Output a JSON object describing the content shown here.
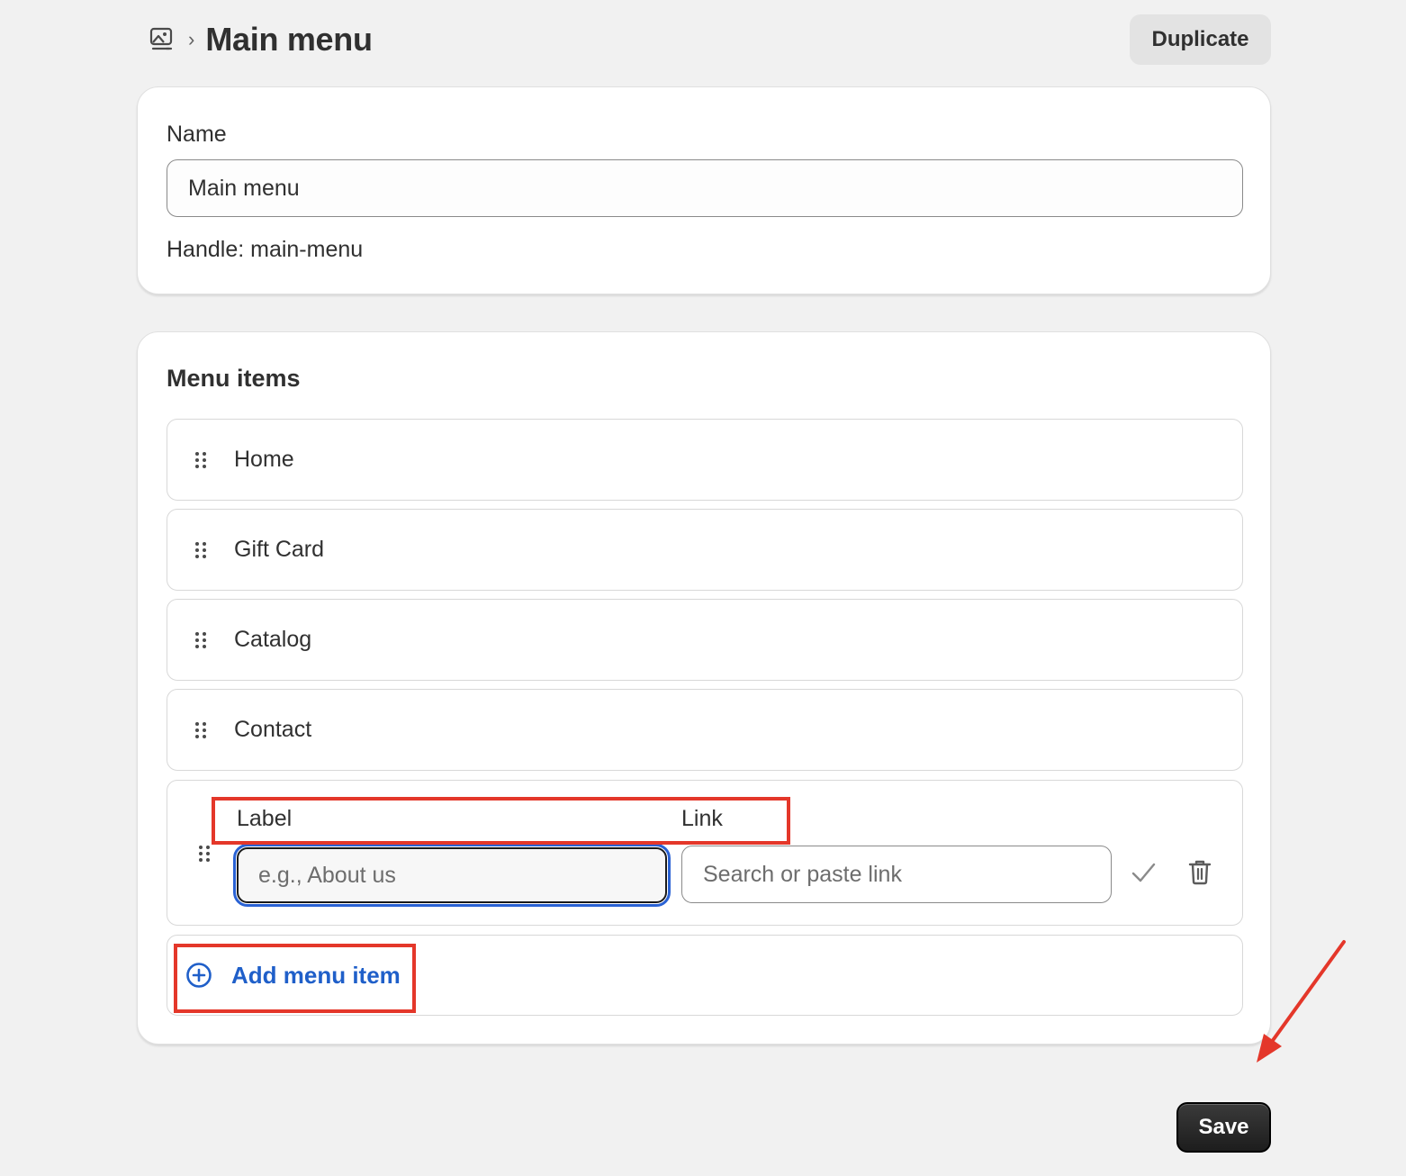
{
  "header": {
    "breadcrumb_icon": "online-store-menu-icon",
    "separator": "›",
    "title": "Main menu",
    "duplicate_label": "Duplicate"
  },
  "name_card": {
    "name_label": "Name",
    "name_value": "Main menu",
    "handle_text": "Handle: main-menu"
  },
  "menu_card": {
    "title": "Menu items",
    "items": [
      {
        "label": "Home"
      },
      {
        "label": "Gift Card"
      },
      {
        "label": "Catalog"
      },
      {
        "label": "Contact"
      }
    ],
    "new_item": {
      "label_header": "Label",
      "link_header": "Link",
      "label_placeholder": "e.g., About us",
      "label_value": "",
      "link_placeholder": "Search or paste link",
      "link_value": "",
      "confirm_icon": "checkmark-icon",
      "delete_icon": "trash-icon"
    },
    "add_item_label": "Add menu item",
    "add_item_icon": "plus-circle-icon"
  },
  "footer": {
    "save_label": "Save"
  },
  "annotations": {
    "highlight_color": "#e4372a",
    "arrow_icon": "red-arrow-pointing-to-save"
  },
  "colors": {
    "background": "#f1f1f1",
    "accent_link": "#1f5fc9",
    "focus_ring": "#2a62d4",
    "primary_button": "#1d1d1d"
  }
}
